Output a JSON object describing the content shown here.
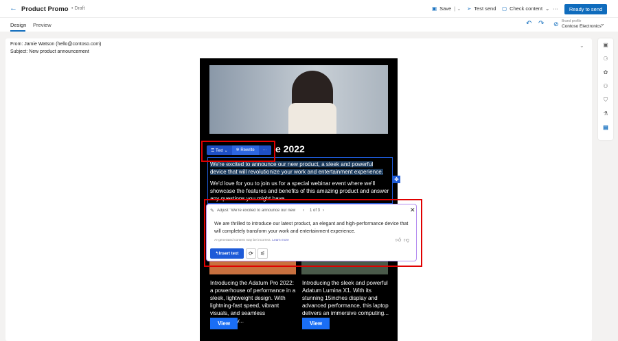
{
  "header": {
    "title": "Product Promo",
    "status": "Draft",
    "save": "Save",
    "test_send": "Test send",
    "check_content": "Check content",
    "more": "···",
    "ready": "Ready to send"
  },
  "tabs": [
    {
      "label": "Design",
      "active": true
    },
    {
      "label": "Preview",
      "active": false
    }
  ],
  "brand": {
    "label": "Brand profile",
    "value": "Contoso Electronics"
  },
  "email": {
    "from": "From: Jamie Watson (hello@contoso.com)",
    "subject": "Subject: New product announcement",
    "heading": "e 2022",
    "para1": "We're excited to announce our new product, a sleek and powerful device that will revolutionize your work and entertainment experience.",
    "para2": "We'd love for you to join us for a special webinar event where we'll showcase the features and benefits of this amazing product and answer any questions you might have.",
    "products": [
      {
        "text": "Introducing the Adatum Pro 2022: a powerhouse of performance in a sleek, lightweight design. With lightning-fast speed, vibrant visuals, and seamless connectivity...",
        "button": "View"
      },
      {
        "text": "Introducing the sleek and powerful Adatum Lumina X1. With its stunning 15inches display and advanced performance, this laptop delivers an immersive computing...",
        "button": "View"
      }
    ]
  },
  "toolbar": {
    "text": "Text",
    "rewrite": "Rewrite",
    "more": "···"
  },
  "panel": {
    "title": "Adjust \"We're excited to announce our new pr...",
    "pager": "1 of 3",
    "suggestion": "We are thrilled to introduce our latest product, an elegant and high-performance device that will completely transform your work and entertainment experience.",
    "disclaimer": "AI-generated content may be incorrect.",
    "learn_more": "Learn more",
    "insert": "Insert text"
  },
  "colors": {
    "accent": "#0f6cbd",
    "highlight": "#1e5bd8",
    "annotation": "#e00000"
  }
}
